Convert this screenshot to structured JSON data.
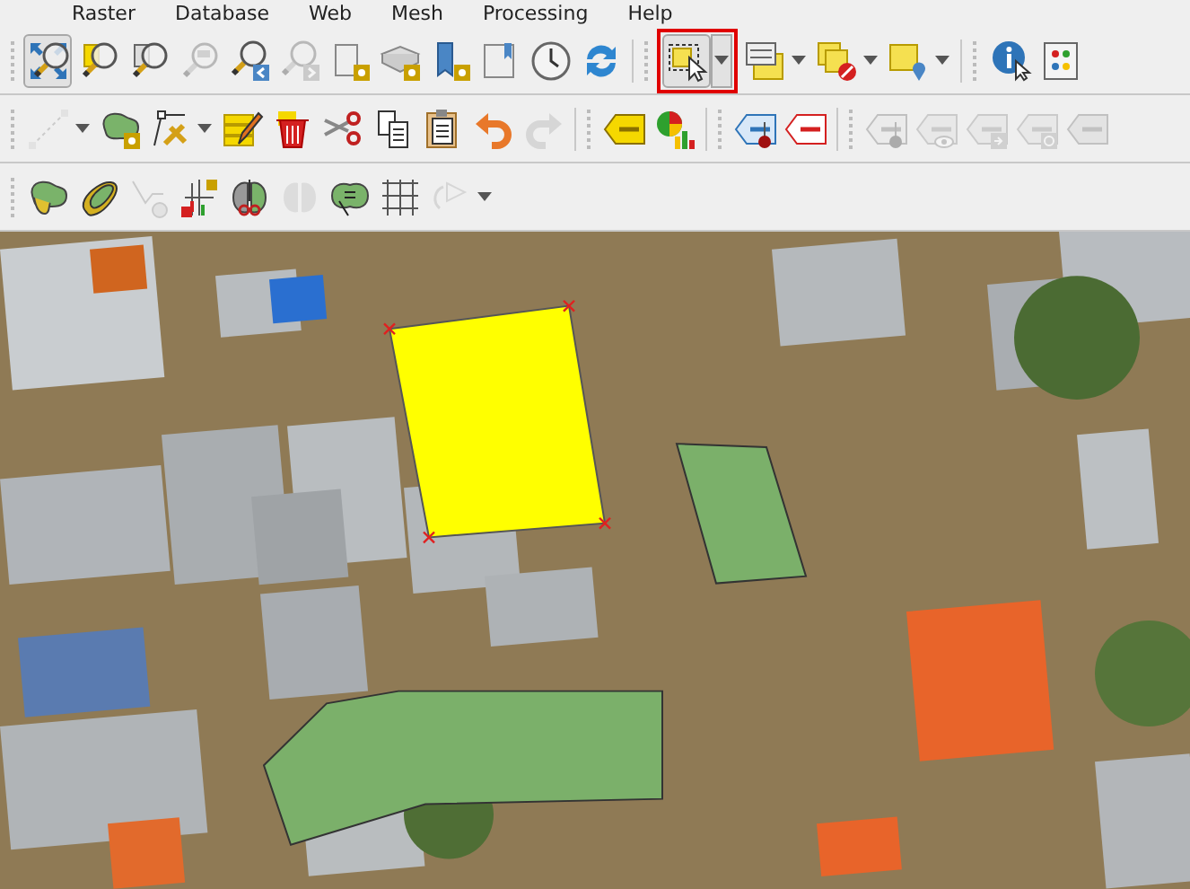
{
  "menu_bar": [
    {
      "label": "Raster"
    },
    {
      "label": "Database"
    },
    {
      "label": "Web"
    },
    {
      "label": "Mesh"
    },
    {
      "label": "Processing"
    },
    {
      "label": "Help"
    }
  ],
  "toolbars": [
    [
      [
        {
          "kind": "zoom-full",
          "disabled": false,
          "selected": true
        },
        {
          "kind": "zoom-selection",
          "disabled": false,
          "selected": false
        },
        {
          "kind": "zoom-layer",
          "disabled": false,
          "selected": false
        },
        {
          "kind": "zoom-native",
          "disabled": true,
          "selected": false
        },
        {
          "kind": "zoom-last",
          "disabled": false,
          "selected": false
        },
        {
          "kind": "zoom-next",
          "disabled": true,
          "selected": false
        },
        {
          "kind": "bookmark-new",
          "disabled": false,
          "selected": false
        },
        {
          "kind": "bookmarks-show",
          "disabled": false,
          "selected": false
        },
        {
          "kind": "bookmark-spatial",
          "disabled": false,
          "selected": false
        },
        {
          "kind": "bookmark",
          "disabled": false,
          "selected": false
        },
        {
          "kind": "clock",
          "disabled": false,
          "selected": false
        },
        {
          "kind": "refresh",
          "disabled": false,
          "selected": false
        }
      ],
      [
        {
          "kind": "select-rect",
          "disabled": false,
          "selected": true,
          "dropdown": true,
          "highlighted": true
        },
        {
          "kind": "select-attr",
          "disabled": false,
          "selected": false,
          "dropdown": true
        },
        {
          "kind": "deselect",
          "disabled": false,
          "selected": false,
          "dropdown": true
        },
        {
          "kind": "select-location",
          "disabled": false,
          "selected": false,
          "dropdown": true
        }
      ],
      [
        {
          "kind": "identify",
          "disabled": false,
          "selected": false
        },
        {
          "kind": "stats",
          "disabled": false,
          "selected": false
        }
      ]
    ],
    [
      [
        {
          "kind": "digitize-line",
          "disabled": true,
          "selected": false,
          "dropdown": true
        },
        {
          "kind": "add-polygon",
          "disabled": false,
          "selected": false
        },
        {
          "kind": "vertex-tool",
          "disabled": false,
          "selected": false,
          "dropdown": true
        },
        {
          "kind": "toggle-edit",
          "disabled": false,
          "selected": false
        },
        {
          "kind": "delete",
          "disabled": false,
          "selected": false
        },
        {
          "kind": "cut",
          "disabled": false,
          "selected": false
        },
        {
          "kind": "copy",
          "disabled": false,
          "selected": false
        },
        {
          "kind": "paste",
          "disabled": false,
          "selected": false
        },
        {
          "kind": "undo",
          "disabled": false,
          "selected": false
        },
        {
          "kind": "redo",
          "disabled": true,
          "selected": false
        }
      ],
      [
        {
          "kind": "label",
          "disabled": false,
          "selected": false
        },
        {
          "kind": "diagram",
          "disabled": false,
          "selected": false
        }
      ],
      [
        {
          "kind": "label-pin",
          "disabled": false,
          "selected": false
        },
        {
          "kind": "label-highlight",
          "disabled": false,
          "selected": false
        }
      ],
      [
        {
          "kind": "label-pin",
          "disabled": true,
          "selected": false
        },
        {
          "kind": "label-show",
          "disabled": true,
          "selected": false
        },
        {
          "kind": "label-move",
          "disabled": true,
          "selected": false
        },
        {
          "kind": "label-rotate",
          "disabled": true,
          "selected": false
        },
        {
          "kind": "label",
          "disabled": true,
          "selected": false
        }
      ]
    ],
    [
      [
        {
          "kind": "reshape",
          "disabled": false,
          "selected": false
        },
        {
          "kind": "offset",
          "disabled": false,
          "selected": false
        },
        {
          "kind": "simplify",
          "disabled": true,
          "selected": false
        },
        {
          "kind": "snap-tools",
          "disabled": false,
          "selected": false
        },
        {
          "kind": "split",
          "disabled": false,
          "selected": false
        },
        {
          "kind": "split-parts",
          "disabled": true,
          "selected": false
        },
        {
          "kind": "merge",
          "disabled": false,
          "selected": false
        },
        {
          "kind": "merge-attributes",
          "disabled": false,
          "selected": false
        },
        {
          "kind": "rotate",
          "disabled": true,
          "selected": false,
          "dropdown": true
        }
      ]
    ]
  ],
  "map": {
    "features": [
      {
        "kind": "building",
        "selected": true
      },
      {
        "kind": "small",
        "selected": false
      },
      {
        "kind": "long",
        "selected": false
      }
    ]
  }
}
